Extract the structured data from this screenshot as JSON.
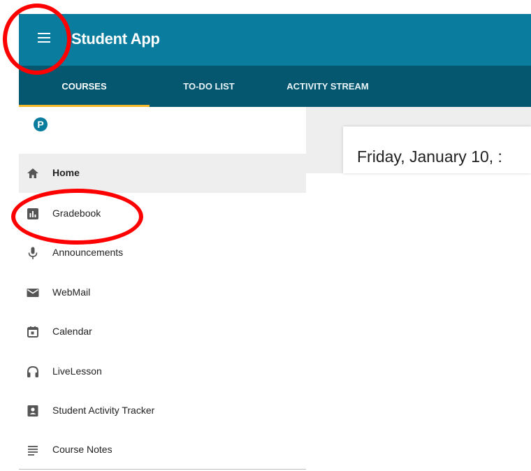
{
  "app": {
    "title": "Student App",
    "menu_icon": "hamburger-menu-icon"
  },
  "tabs": [
    {
      "label": "COURSES",
      "active": true
    },
    {
      "label": "TO-DO LIST",
      "active": false
    },
    {
      "label": "ACTIVITY STREAM",
      "active": false
    }
  ],
  "sidebar": {
    "logo_letter": "P",
    "items": [
      {
        "label": "Home",
        "icon": "home-icon",
        "active": true
      },
      {
        "label": "Gradebook",
        "icon": "gradebook-chart-icon",
        "active": false
      },
      {
        "label": "Announcements",
        "icon": "microphone-icon",
        "active": false
      },
      {
        "label": "WebMail",
        "icon": "mail-icon",
        "active": false
      },
      {
        "label": "Calendar",
        "icon": "calendar-icon",
        "active": false
      },
      {
        "label": "LiveLesson",
        "icon": "headphones-icon",
        "active": false
      },
      {
        "label": "Student Activity Tracker",
        "icon": "contact-card-icon",
        "active": false
      },
      {
        "label": "Course Notes",
        "icon": "notes-lines-icon",
        "active": false
      }
    ]
  },
  "main": {
    "date": "Friday, January 10, :"
  },
  "colors": {
    "topbar": "#0a7c9d",
    "tabbar": "#05566f",
    "tab_indicator": "#f2b72a",
    "annotation": "#ff0000"
  }
}
